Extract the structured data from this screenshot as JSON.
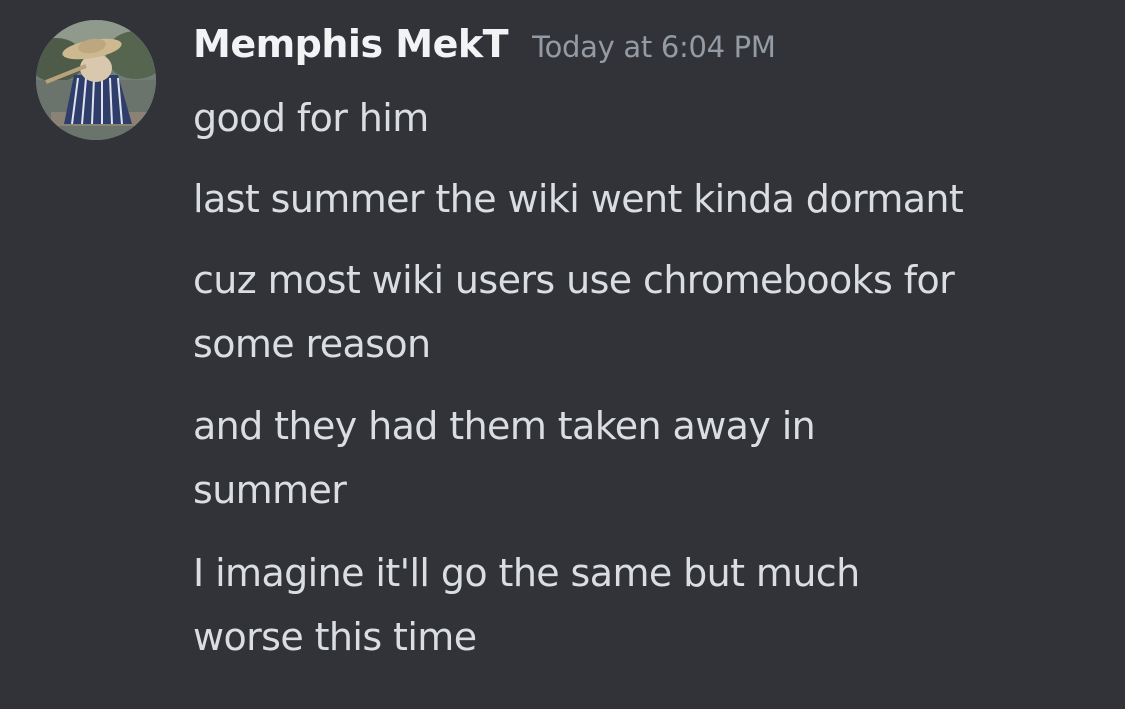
{
  "message": {
    "author": "Memphis MekT",
    "timestamp": "Today at 6:04 PM",
    "avatar_icon": "user-avatar-icon",
    "lines": [
      {
        "text": "good for him"
      },
      {
        "text": "last summer the wiki went kinda dormant"
      },
      {
        "text_line1": "cuz most wiki users use chromebooks for",
        "text_line2": "some reason"
      },
      {
        "text_line1": "and they had them taken away in",
        "text_line2": "summer"
      },
      {
        "text_line1": "I imagine it'll go the same but much",
        "text_line2": "worse this time"
      }
    ]
  },
  "colors": {
    "background": "#313338",
    "username": "#f2f3f5",
    "timestamp": "#949ba4",
    "message_text": "#dbdee1"
  }
}
